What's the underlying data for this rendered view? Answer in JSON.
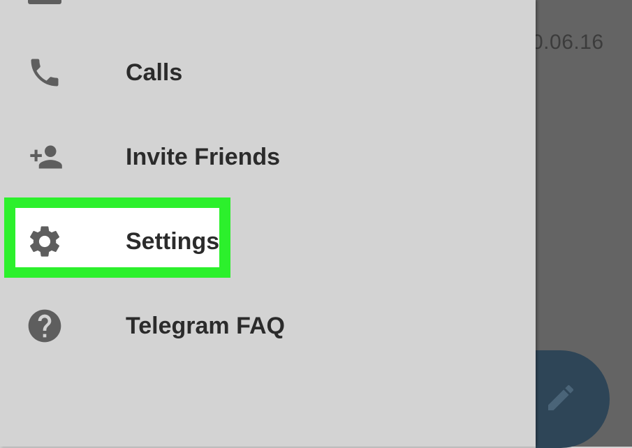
{
  "background": {
    "date_text": "0.06.16",
    "compose_icon": "pencil-icon"
  },
  "drawer": {
    "items": [
      {
        "label": "Calls",
        "icon": "phone-icon"
      },
      {
        "label": "Invite Friends",
        "icon": "add-person-icon"
      },
      {
        "label": "Settings",
        "icon": "gear-icon"
      },
      {
        "label": "Telegram FAQ",
        "icon": "help-circle-icon"
      }
    ],
    "highlighted_item": "Settings"
  },
  "colors": {
    "drawer_background": "#d3d3d3",
    "highlight_border": "#2cf02c",
    "icon": "#5e5e5e",
    "fab": "#2e4557"
  }
}
